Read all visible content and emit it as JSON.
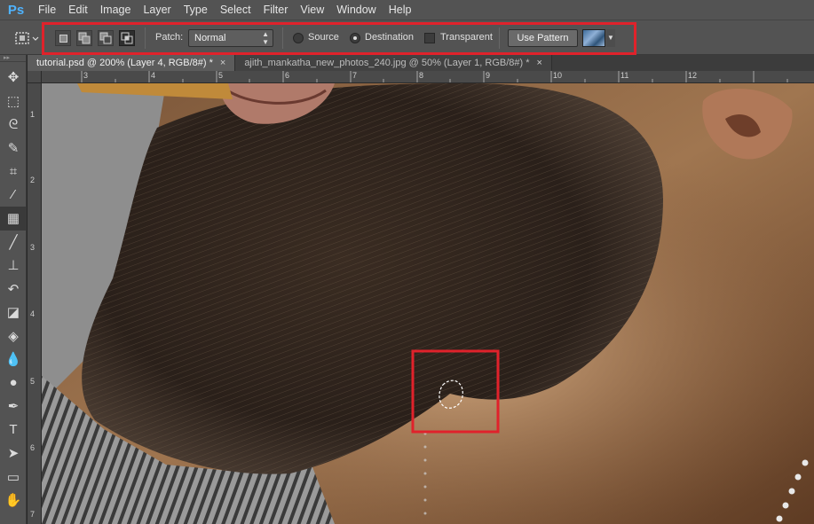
{
  "app": {
    "logo": "Ps"
  },
  "menu": [
    "File",
    "Edit",
    "Image",
    "Layer",
    "Type",
    "Select",
    "Filter",
    "View",
    "Window",
    "Help"
  ],
  "options": {
    "patch_label": "Patch:",
    "patch_value": "Normal",
    "source_label": "Source",
    "destination_label": "Destination",
    "transparent_label": "Transparent",
    "use_pattern_label": "Use Pattern",
    "selected_radio": "Destination",
    "transparent_checked": false
  },
  "tabs": [
    {
      "label": "tutorial.psd @ 200% (Layer 4, RGB/8#) *",
      "close": "×",
      "active": true
    },
    {
      "label": "ajith_mankatha_new_photos_240.jpg @ 50% (Layer 1, RGB/8#) *",
      "close": "×",
      "active": false
    }
  ],
  "hruler": {
    "numbers": [
      "3",
      "4",
      "5",
      "6",
      "7",
      "8",
      "9",
      "10",
      "11",
      "12"
    ]
  },
  "vruler": {
    "numbers": [
      "1",
      "2",
      "3",
      "4",
      "5",
      "6",
      "7"
    ]
  },
  "tools": [
    "move-tool",
    "marquee-tool",
    "lasso-tool",
    "quick-selection-tool",
    "crop-tool",
    "eyedropper-tool",
    "patch-tool",
    "brush-tool",
    "clone-stamp-tool",
    "history-brush-tool",
    "eraser-tool",
    "paint-bucket-tool",
    "blur-tool",
    "dodge-tool",
    "pen-tool",
    "type-tool",
    "path-selection-tool",
    "rectangle-tool",
    "hand-tool"
  ],
  "colors": {
    "highlight": "#e0222b",
    "ui_dark": "#535353",
    "canvas_bg": "#282828"
  }
}
